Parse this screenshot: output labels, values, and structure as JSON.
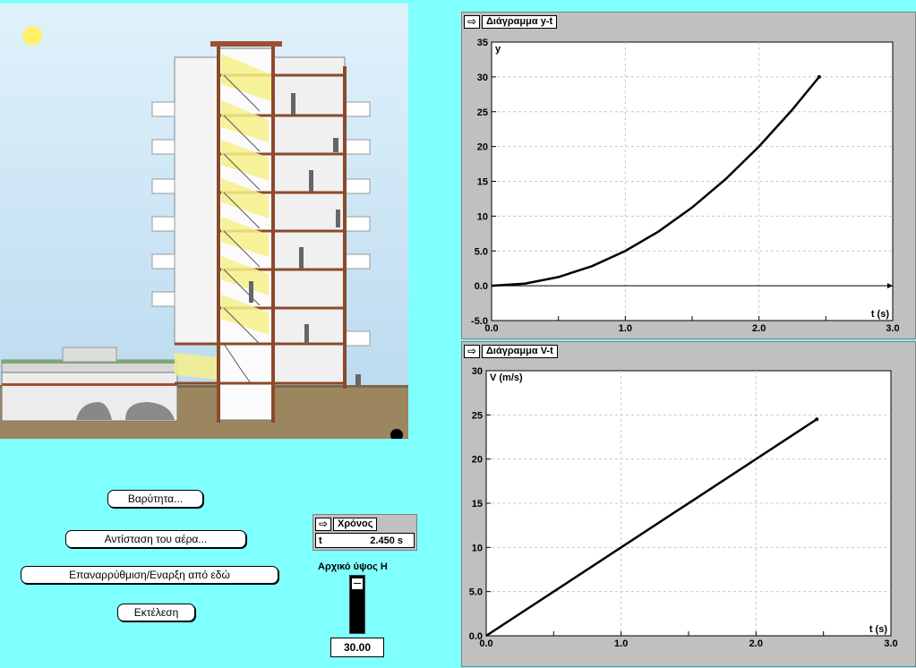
{
  "buttons": {
    "gravity": "Βαρύτητα...",
    "air_resistance": "Αντίσταση του αέρα...",
    "reset": "Επαναρρύθμιση/Εναρξη από εδώ",
    "run": "Εκτέλεση"
  },
  "timer": {
    "title": "Χρόνος",
    "var": "t",
    "value": "2.450 s"
  },
  "height_control": {
    "label": "Αρχικό ύψος Η",
    "value": "30.00",
    "level": 1.0
  },
  "icons": {
    "panel_arrow": "arrow-right-icon",
    "sun": "sun-icon",
    "ball": "ball-icon"
  },
  "chart_data": [
    {
      "type": "line",
      "title": "Διάγραμμα y-t",
      "xlabel": "t (s)",
      "ylabel": "y",
      "xlim": [
        0,
        3.0
      ],
      "ylim": [
        -5.0,
        35
      ],
      "xticks": [
        "0.0",
        "1.0",
        "2.0",
        "3.0"
      ],
      "yticks": [
        "-5.0",
        "0.0",
        "5.0",
        "10",
        "15",
        "20",
        "25",
        "30",
        "35"
      ],
      "grid": true,
      "series": [
        {
          "x": [
            0,
            0.25,
            0.5,
            0.75,
            1.0,
            1.25,
            1.5,
            1.75,
            2.0,
            2.25,
            2.45
          ],
          "y": [
            0,
            0.31,
            1.25,
            2.81,
            5.0,
            7.81,
            11.25,
            15.31,
            20.0,
            25.31,
            30.0
          ]
        }
      ]
    },
    {
      "type": "line",
      "title": "Διάγραμμα V-t",
      "xlabel": "t (s)",
      "ylabel": "V (m/s)",
      "xlim": [
        0,
        3.0
      ],
      "ylim": [
        0,
        30
      ],
      "xticks": [
        "0.0",
        "1.0",
        "2.0",
        "3.0"
      ],
      "yticks": [
        "0.0",
        "5.0",
        "10",
        "15",
        "20",
        "25",
        "30"
      ],
      "grid": true,
      "series": [
        {
          "x": [
            0,
            2.45
          ],
          "y": [
            0,
            24.5
          ]
        }
      ]
    }
  ]
}
